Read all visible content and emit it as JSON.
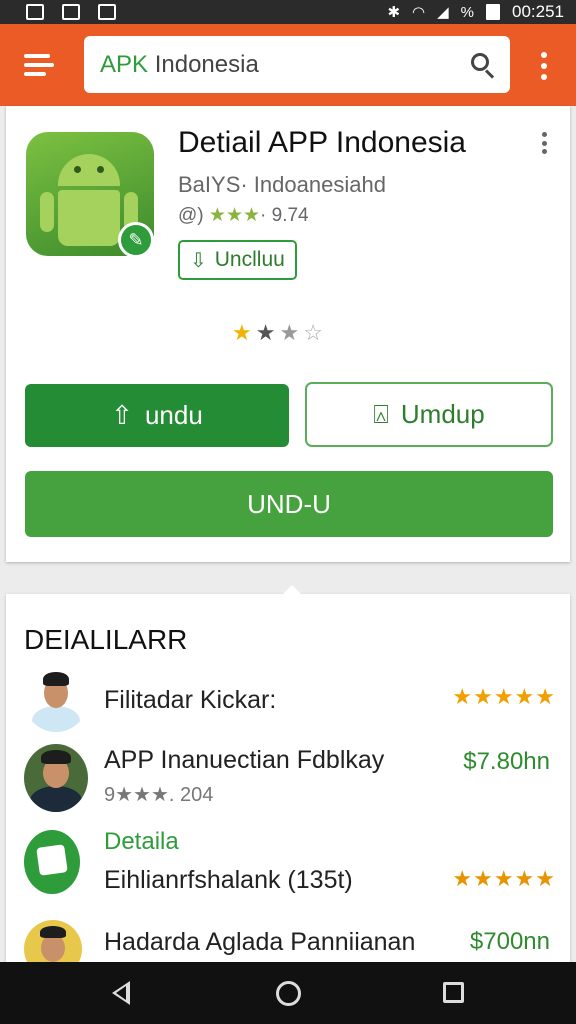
{
  "status_bar": {
    "time": "00:251",
    "signal_label": "%"
  },
  "search": {
    "prefix": "APK",
    "rest": " Indonesia"
  },
  "app": {
    "title": "Detiail APP Indonesia",
    "developer": "BaIYS· Indoanesiahd",
    "meta_prefix": "@) ",
    "meta_stars": "★★★",
    "meta_value": "· 9.74",
    "chip_label": "Unclluu",
    "rating_stars": [
      "★",
      "★",
      "★",
      "☆"
    ],
    "primary_button": "undu",
    "outline_button": "Umdup",
    "wide_button": "UND-U"
  },
  "details": {
    "section_title": "DEIALILARR",
    "items": [
      {
        "title": "Filitadar Kickar:",
        "stars": "★★★★★"
      },
      {
        "title": "APP Inanuectian Fdblkay",
        "subtitle": "9★★★. 204",
        "price": "$7.80hn"
      },
      {
        "label": "Detaila",
        "title": "Eihlianrfshalank (135t)",
        "stars": "★★★★★"
      },
      {
        "title": "Hadarda Aglada Panniianan",
        "price": "$700nn"
      }
    ]
  },
  "colors": {
    "accent": "#ea5b26",
    "primary_green": "#248c34",
    "secondary_green": "#45a23e"
  },
  "icons": [
    "menu-icon",
    "search-icon",
    "overflow-icon",
    "android-icon",
    "download-icon",
    "back-icon",
    "home-icon",
    "recent-apps-icon"
  ]
}
